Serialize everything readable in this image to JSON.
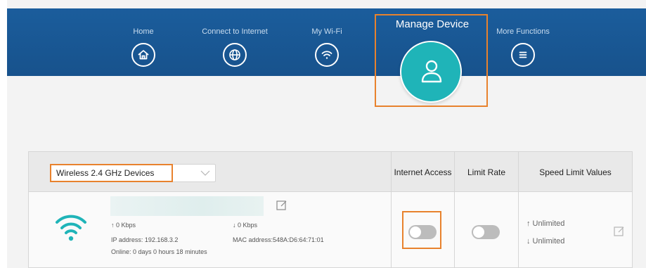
{
  "nav": {
    "items": [
      {
        "label": "Home",
        "icon": "home-icon"
      },
      {
        "label": "Connect to Internet",
        "icon": "globe-icon"
      },
      {
        "label": "My Wi-Fi",
        "icon": "wifi-icon"
      },
      {
        "label": "Manage Device",
        "icon": "user-icon",
        "active": true
      },
      {
        "label": "More Functions",
        "icon": "menu-icon"
      }
    ]
  },
  "table": {
    "device_filter": {
      "selected": "Wireless 2.4 GHz Devices"
    },
    "headers": {
      "internet_access": "Internet Access",
      "limit_rate": "Limit Rate",
      "speed_limit_values": "Speed Limit Values"
    },
    "rows": [
      {
        "connection_icon": "wifi-icon",
        "upload_rate": "↑ 0 Kbps",
        "download_rate": "↓ 0 Kbps",
        "ip_address": "IP address: 192.168.3.2",
        "mac_address": "MAC address:548A:D6:64:71:01",
        "online_time": "Online: 0 days 0 hours 18 minutes",
        "internet_access_enabled": false,
        "limit_rate_enabled": false,
        "upload_limit": "↑ Unlimited",
        "download_limit": "↓ Unlimited"
      }
    ]
  },
  "colors": {
    "nav_background": "#1b5d9c",
    "active_circle": "#1fb4b8",
    "highlight": "#e8822d",
    "wifi_icon": "#1fb4b8",
    "toggle_off": "#bcbcbc"
  }
}
